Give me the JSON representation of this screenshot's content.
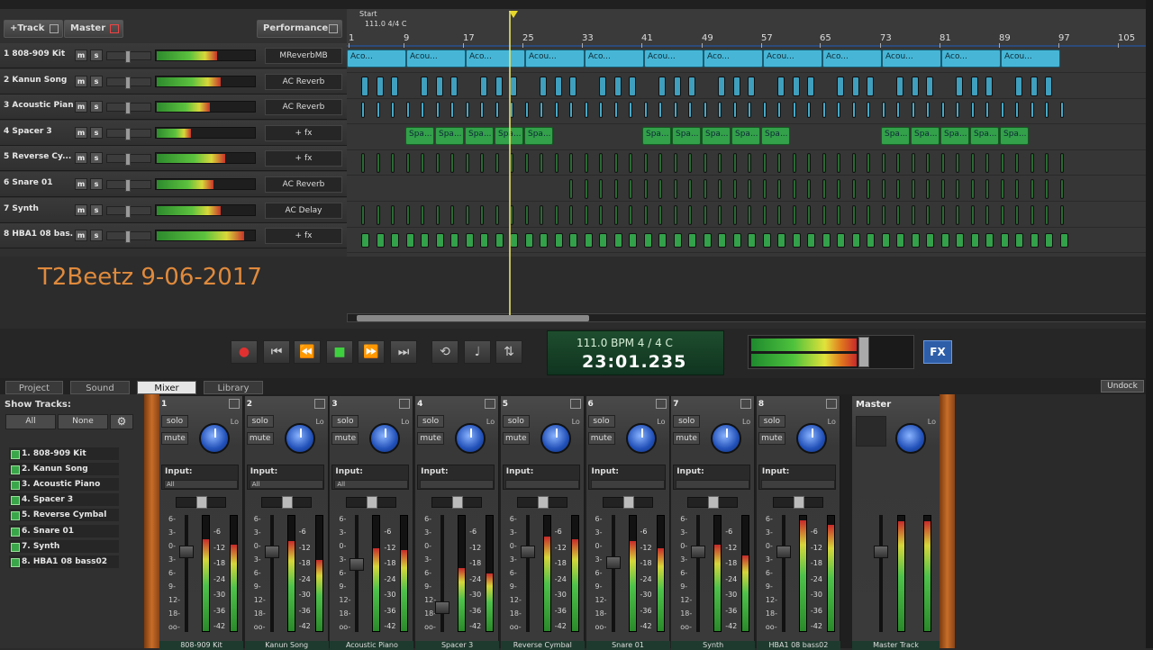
{
  "header": {
    "add_track": "+Track",
    "master": "Master",
    "performance": "Performance"
  },
  "ruler": {
    "start_label": "Start",
    "tempo_label": "111.0 4/4 C",
    "bars": [
      "1",
      "9",
      "17",
      "25",
      "33",
      "41",
      "49",
      "57",
      "65",
      "73",
      "81",
      "89",
      "97",
      "105"
    ]
  },
  "tracks": [
    {
      "name": "1 808-909 Kit",
      "fx": "MReverbMB",
      "meter": 0.62
    },
    {
      "name": "2 Kanun Song",
      "fx": "AC Reverb",
      "meter": 0.66
    },
    {
      "name": "3 Acoustic Piano",
      "fx": "AC Reverb",
      "meter": 0.55
    },
    {
      "name": "4 Spacer 3",
      "fx": "+ fx",
      "meter": 0.35
    },
    {
      "name": "5 Reverse Cy...",
      "fx": "+ fx",
      "meter": 0.7
    },
    {
      "name": "6 Snare 01",
      "fx": "AC Reverb",
      "meter": 0.58
    },
    {
      "name": "7 Synth",
      "fx": "AC Delay",
      "meter": 0.66
    },
    {
      "name": "8 HBA1 08 bas...",
      "fx": "+ fx",
      "meter": 0.9
    }
  ],
  "track_buttons": {
    "mute": "m",
    "solo": "s"
  },
  "clips": {
    "acoustic": "Aco...",
    "acoustic_long": "Acou...",
    "spacer": "Spa..."
  },
  "stamp": "T2Beetz 9-06-2017",
  "transport": {
    "bpm_line": "111.0 BPM  4 / 4   C",
    "time": "23:01.235",
    "fx": "FX",
    "record": "record",
    "rewind_start": "rewind-to-start",
    "rewind": "rewind",
    "play": "play",
    "forward": "fast-forward",
    "end": "go-to-end",
    "loop": "loop",
    "metronome": "metronome",
    "mix": "mixdown",
    "master_level": 0.66
  },
  "tabs": {
    "project": "Project",
    "sound": "Sound",
    "mixer": "Mixer",
    "library": "Library",
    "undock": "Undock"
  },
  "show_tracks": {
    "title": "Show Tracks:",
    "all": "All",
    "none": "None",
    "items": [
      "1. 808-909 Kit",
      "2. Kanun Song",
      "3. Acoustic Piano",
      "4. Spacer 3",
      "5. Reverse Cymbal",
      "6. Snare 01",
      "7. Synth",
      "8. HBA1 08 bass02"
    ]
  },
  "mixer": {
    "solo": "solo",
    "mute": "mute",
    "lo": "Lo",
    "input": "Input:",
    "scale_left": [
      "6-",
      "3-",
      "0-",
      "3-",
      "6-",
      "9-",
      "12-",
      "18-",
      "oo-"
    ],
    "scale_right": [
      "-6",
      "-12",
      "-18",
      "-24",
      "-30",
      "-36",
      "-42"
    ],
    "channels": [
      {
        "num": "1",
        "input_sel": "All",
        "name": "808-909 Kit",
        "level_l": 0.8,
        "level_r": 0.75,
        "fader": 0.72
      },
      {
        "num": "2",
        "input_sel": "All",
        "name": "Kanun Song",
        "level_l": 0.78,
        "level_r": 0.62,
        "fader": 0.72
      },
      {
        "num": "3",
        "input_sel": "All",
        "name": "Acoustic Piano",
        "level_l": 0.72,
        "level_r": 0.7,
        "fader": 0.6
      },
      {
        "num": "4",
        "input_sel": "",
        "name": "Spacer 3",
        "level_l": 0.55,
        "level_r": 0.5,
        "fader": 0.2
      },
      {
        "num": "5",
        "input_sel": "",
        "name": "Reverse Cymbal",
        "level_l": 0.82,
        "level_r": 0.8,
        "fader": 0.72
      },
      {
        "num": "6",
        "input_sel": "",
        "name": "Snare 01",
        "level_l": 0.78,
        "level_r": 0.72,
        "fader": 0.62
      },
      {
        "num": "7",
        "input_sel": "",
        "name": "Synth",
        "level_l": 0.75,
        "level_r": 0.66,
        "fader": 0.72
      },
      {
        "num": "8",
        "input_sel": "",
        "name": "HBA1 08 bass02",
        "level_l": 0.96,
        "level_r": 0.92,
        "fader": 0.72
      }
    ],
    "master": {
      "title": "Master",
      "name": "Master Track",
      "level_l": 0.95,
      "level_r": 0.95,
      "fader": 0.72
    }
  }
}
